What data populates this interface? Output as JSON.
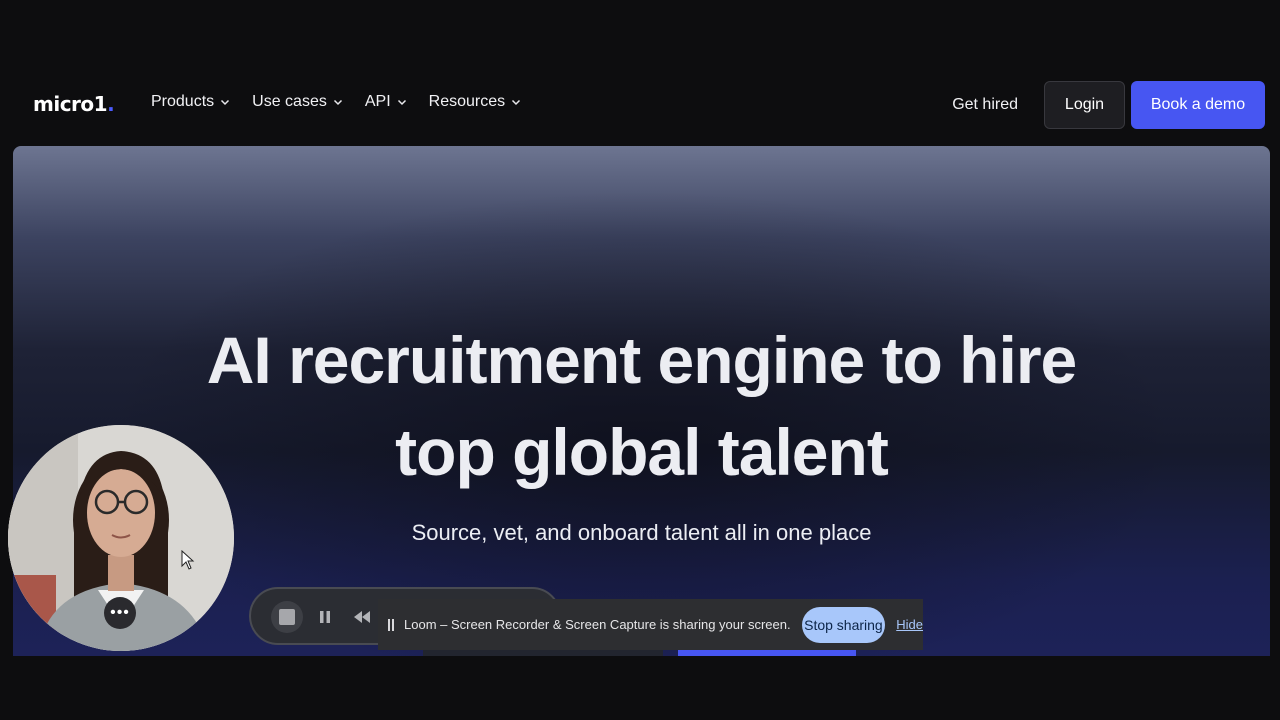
{
  "nav": {
    "logo_text": "micro1",
    "logo_dot": ".",
    "menu": [
      {
        "label": "Products"
      },
      {
        "label": "Use cases"
      },
      {
        "label": "API"
      },
      {
        "label": "Resources"
      }
    ],
    "get_hired": "Get hired",
    "login": "Login",
    "book_demo": "Book a demo"
  },
  "hero": {
    "title_line1": "AI recruitment engine to hire",
    "title_line2": "top global talent",
    "subtitle": "Source, vet, and onboard talent all in one place"
  },
  "recorder": {
    "share_text": "Loom – Screen Recorder & Screen Capture is sharing your screen.",
    "stop_sharing": "Stop sharing",
    "hide": "Hide",
    "more_glyph": "•••"
  },
  "colors": {
    "accent": "#4756f2",
    "stop_sharing_bg": "#a8c7fa"
  }
}
